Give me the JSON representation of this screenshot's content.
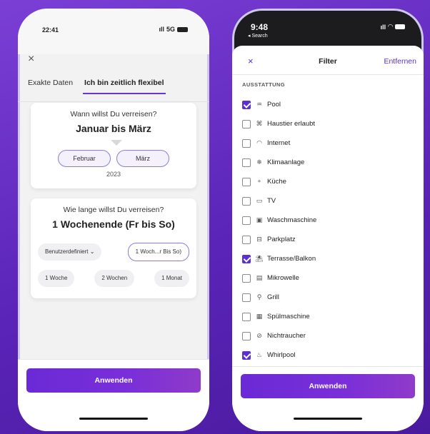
{
  "left": {
    "status": {
      "time": "22:41",
      "network": "5G"
    },
    "close_icon": "×",
    "tabs": [
      "Exakte Daten",
      "Ich bin zeitlich flexibel"
    ],
    "when": {
      "question": "Wann willst Du verreisen?",
      "answer": "Januar  bis März",
      "months": [
        "Februar",
        "März"
      ],
      "year": "2023"
    },
    "duration": {
      "question": "Wie lange willst Du verreisen?",
      "answer": "1 Wochenende (Fr bis So)",
      "custom_label": "Benutzerdefiniert",
      "selected_chip": "1 Woch...r Bis So)",
      "options": [
        "1 Woche",
        "2 Wochen",
        "1 Monat"
      ]
    },
    "apply_label": "Anwenden"
  },
  "right": {
    "status": {
      "time": "9:48",
      "back": "◂ Search"
    },
    "header": {
      "close_icon": "×",
      "title": "Filter",
      "remove_label": "Entfernen"
    },
    "section_label": "AUSSTATTUNG",
    "items": [
      {
        "label": "Pool",
        "checked": true,
        "icon": "pool-icon",
        "glyph": "♒"
      },
      {
        "label": "Haustier erlaubt",
        "checked": false,
        "icon": "pet-icon",
        "glyph": "⌘"
      },
      {
        "label": "Internet",
        "checked": false,
        "icon": "wifi-icon",
        "glyph": "◠"
      },
      {
        "label": "Klimaanlage",
        "checked": false,
        "icon": "snowflake-icon",
        "glyph": "❄"
      },
      {
        "label": "Küche",
        "checked": false,
        "icon": "kitchen-icon",
        "glyph": "⚬"
      },
      {
        "label": "TV",
        "checked": false,
        "icon": "tv-icon",
        "glyph": "▭"
      },
      {
        "label": "Waschmaschine",
        "checked": false,
        "icon": "washer-icon",
        "glyph": "▣"
      },
      {
        "label": "Parkplatz",
        "checked": false,
        "icon": "car-icon",
        "glyph": "⊟"
      },
      {
        "label": "Terrasse/Balkon",
        "checked": true,
        "icon": "balcony-icon",
        "glyph": "⛱"
      },
      {
        "label": "Mikrowelle",
        "checked": false,
        "icon": "microwave-icon",
        "glyph": "▤"
      },
      {
        "label": "Grill",
        "checked": false,
        "icon": "grill-icon",
        "glyph": "⚲"
      },
      {
        "label": "Spülmaschine",
        "checked": false,
        "icon": "dishwasher-icon",
        "glyph": "▦"
      },
      {
        "label": "Nichtraucher",
        "checked": false,
        "icon": "no-smoking-icon",
        "glyph": "⊘"
      },
      {
        "label": "Whirlpool",
        "checked": true,
        "icon": "whirlpool-icon",
        "glyph": "♨"
      }
    ],
    "apply_label": "Anwenden"
  },
  "colors": {
    "accent": "#5b2fd0",
    "background": "#6a2fcf"
  }
}
